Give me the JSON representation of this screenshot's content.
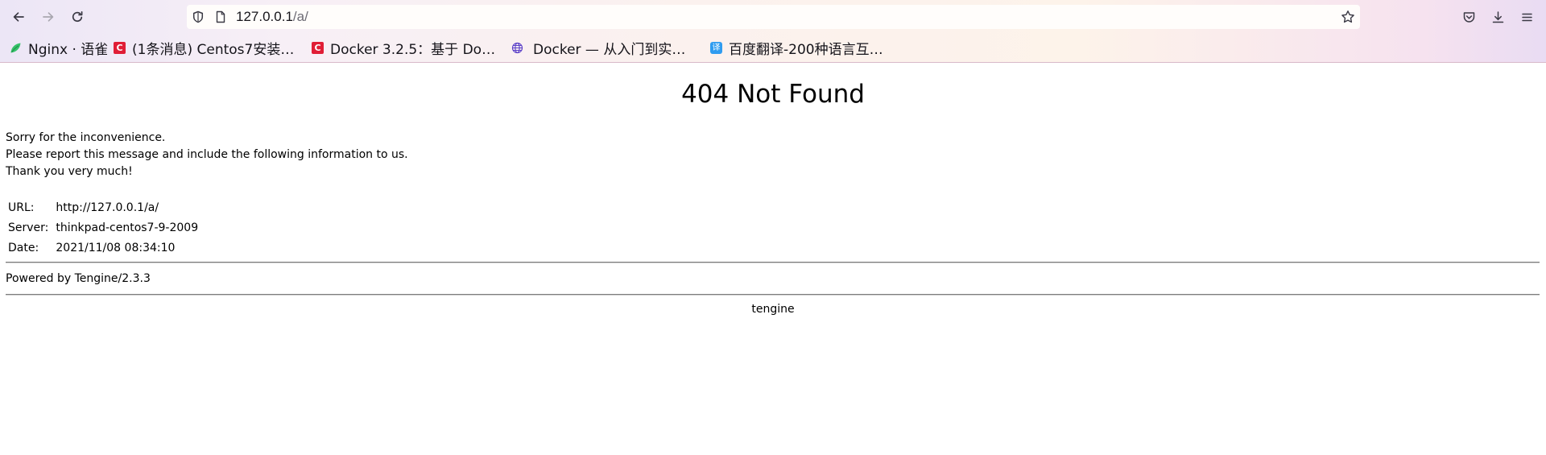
{
  "browser": {
    "url_host": "127.0.0.1",
    "url_path": "/a/",
    "back_icon": "arrow-left-icon",
    "forward_icon": "arrow-right-icon",
    "reload_icon": "reload-icon",
    "shield_icon": "shield-icon",
    "page_icon": "page-icon",
    "star_icon": "star-icon",
    "pocket_icon": "pocket-icon",
    "downloads_icon": "download-icon",
    "menu_icon": "hamburger-menu-icon"
  },
  "bookmarks": [
    {
      "label": "Nginx · 语雀",
      "icon": "yuque-leaf-icon",
      "color": "#36c26a"
    },
    {
      "label": "(1条消息) Centos7安装…",
      "icon": "csdn-c-icon",
      "color": "#e01e36"
    },
    {
      "label": "Docker 3.2.5：基于 Do…",
      "icon": "csdn-c-icon",
      "color": "#e01e36"
    },
    {
      "label": "Docker — 从入门到实…",
      "icon": "globe-icon",
      "color": "#5a3fc8"
    },
    {
      "label": "百度翻译-200种语言互…",
      "icon": "baidu-translate-icon",
      "color": "#2f9cf0"
    }
  ],
  "page": {
    "title": "404 Not Found",
    "line1": "Sorry for the inconvenience.",
    "line2": "Please report this message and include the following information to us.",
    "line3": "Thank you very much!",
    "info": [
      {
        "key": "URL:",
        "value": "http://127.0.0.1/a/"
      },
      {
        "key": "Server:",
        "value": "thinkpad-centos7-9-2009"
      },
      {
        "key": "Date:",
        "value": "2021/11/08 08:34:10"
      }
    ],
    "powered_by": "Powered by Tengine/2.3.3",
    "footer": "tengine"
  }
}
